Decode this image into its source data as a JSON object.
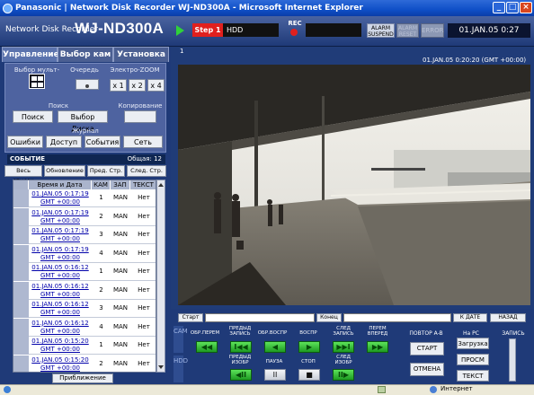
{
  "window": {
    "title": "Panasonic | Network Disk Recorder WJ-ND300A - Microsoft Internet Explorer"
  },
  "header": {
    "brand_sub": "Network Disk Recorder",
    "brand_main": "WJ-ND300A",
    "step": "Step 1",
    "hdd": "HDD",
    "rec": "REC",
    "alarm_suspend": "ALARM SUSPEND",
    "alarm_reset": "ALARM RESET",
    "error": "ERROR",
    "clock": "01.JAN.05   0:27"
  },
  "tabs": [
    "Управление",
    "Выбор кам",
    "Установка"
  ],
  "controls": {
    "multiscreen_label": "Выбор мульт-экр",
    "sequence_label": "Очередь",
    "ezoom_label": "Электро-ZOOM",
    "zoom": [
      "x 1",
      "x 2",
      "x 4"
    ]
  },
  "search": {
    "label": "Поиск",
    "search_btn": "Поиск",
    "disk_btn": "Выбор Диска",
    "copy_label": "Копирование"
  },
  "journal": {
    "label": "Журнал",
    "items": [
      "Ошибки",
      "Доступ",
      "События",
      "Сеть"
    ]
  },
  "events": {
    "title": "СОБЫТИЕ",
    "total": "Общая: 12",
    "actions": [
      "Весь список",
      "Обновление",
      "Пред. Стр.",
      "След. Стр."
    ],
    "columns": [
      "Время и Дата",
      "КАМ",
      "ЗАП",
      "ТЕКСТ"
    ],
    "rows": [
      {
        "date": "01.JAN.05  0:17:19",
        "gmt": "GMT +00:00",
        "cam": "1",
        "rec": "MAN",
        "text": "Нет"
      },
      {
        "date": "01.JAN.05  0:17:19",
        "gmt": "GMT +00:00",
        "cam": "2",
        "rec": "MAN",
        "text": "Нет"
      },
      {
        "date": "01.JAN.05  0:17:19",
        "gmt": "GMT +00:00",
        "cam": "3",
        "rec": "MAN",
        "text": "Нет"
      },
      {
        "date": "01.JAN.05  0:17:19",
        "gmt": "GMT +00:00",
        "cam": "4",
        "rec": "MAN",
        "text": "Нет"
      },
      {
        "date": "01.JAN.05  0:16:12",
        "gmt": "GMT +00:00",
        "cam": "1",
        "rec": "MAN",
        "text": "Нет"
      },
      {
        "date": "01.JAN.05  0:16:12",
        "gmt": "GMT +00:00",
        "cam": "2",
        "rec": "MAN",
        "text": "Нет"
      },
      {
        "date": "01.JAN.05  0:16:12",
        "gmt": "GMT +00:00",
        "cam": "3",
        "rec": "MAN",
        "text": "Нет"
      },
      {
        "date": "01.JAN.05  0:16:12",
        "gmt": "GMT +00:00",
        "cam": "4",
        "rec": "MAN",
        "text": "Нет"
      },
      {
        "date": "01.JAN.05  0:15:20",
        "gmt": "GMT +00:00",
        "cam": "1",
        "rec": "MAN",
        "text": "Нет"
      },
      {
        "date": "01.JAN.05  0:15:20",
        "gmt": "GMT +00:00",
        "cam": "2",
        "rec": "MAN",
        "text": "Нет"
      }
    ],
    "footer_btn": "Приближение"
  },
  "video": {
    "cam_number": "1",
    "date": "01.JAN.05   0:20:20 (GMT +00:00)"
  },
  "playback": {
    "start_label": "Старт",
    "end_label": "Конец",
    "date_btn": "К ДАТЕ",
    "back_btn": "НАЗАД",
    "cam": "CAM",
    "hdd": "HDD",
    "labels": [
      "ОБР.ПЕРЕМ",
      "ПРЕДЫД ЗАПИСЬ",
      "ОБР.ВОСПР",
      "ВОСПР",
      "СЛЕД ЗАПИСЬ",
      "ПЕРЕМ ВПЕРЕД",
      "ПРЕДЫД ИЗОБР",
      "ПАУЗА",
      "СТОП",
      "СЛЕД ИЗОБР"
    ],
    "ab_label": "ПОВТОР A-B",
    "ab_start": "СТАРТ",
    "cancel": "ОТМЕНА",
    "pc_label": "На PC",
    "download": "Загрузка",
    "view": "ПРОСМ",
    "text_btn": "ТЕКСТ",
    "rec_label": "ЗАПИСЬ"
  },
  "status": {
    "zone": "Интернет"
  }
}
